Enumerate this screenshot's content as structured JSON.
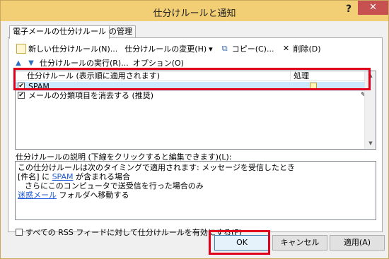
{
  "window": {
    "title": "仕分けルールと通知",
    "help_symbol": "?",
    "close_symbol": "✕"
  },
  "tabs": [
    {
      "label": "電子メールの仕分けルール"
    },
    {
      "label": "通知の管理"
    }
  ],
  "toolbar": {
    "new_rule": "新しい仕分けルール(N)...",
    "change_rule": "仕分けルールの変更(H)",
    "change_arrow": "▾",
    "copy": "コピー(C)...",
    "delete": "削除(D)"
  },
  "toolbar2": {
    "up_arrow": "▲",
    "down_arrow": "▼",
    "run_rules": "仕分けルールの実行(R)...",
    "options": "オプション(O)"
  },
  "rules_list": {
    "col_rule": "仕分けルール (表示順に適用されます)",
    "col_action": "処理",
    "rows": [
      {
        "label": "SPAM",
        "checked": "✔"
      },
      {
        "label": "メールの分類項目を消去する (推奨)",
        "checked": "✔"
      }
    ]
  },
  "description": {
    "label": "仕分けルールの説明 (下線をクリックすると編集できます)(L):",
    "line1": "この仕分けルールは次のタイミングで適用されます: メッセージを受信したとき",
    "line2_prefix": "[件名] に ",
    "line2_link": "SPAM",
    "line2_suffix": " が含まれる場合",
    "line3": "さらにこのコンピュータで送受信を行った場合のみ",
    "line4_link": "迷惑メール",
    "line4_suffix": " フォルダへ移動する"
  },
  "rss_option": "すべての RSS フィードに対して仕分けルールを有効にする(F)",
  "buttons": {
    "ok": "OK",
    "cancel": "キャンセル",
    "apply": "適用(A)"
  },
  "colors": {
    "titlebar": "#f2cf75",
    "close": "#c75050",
    "annotation": "#e0001b",
    "selection": "#cce8ff",
    "link": "#1e5bd6"
  }
}
